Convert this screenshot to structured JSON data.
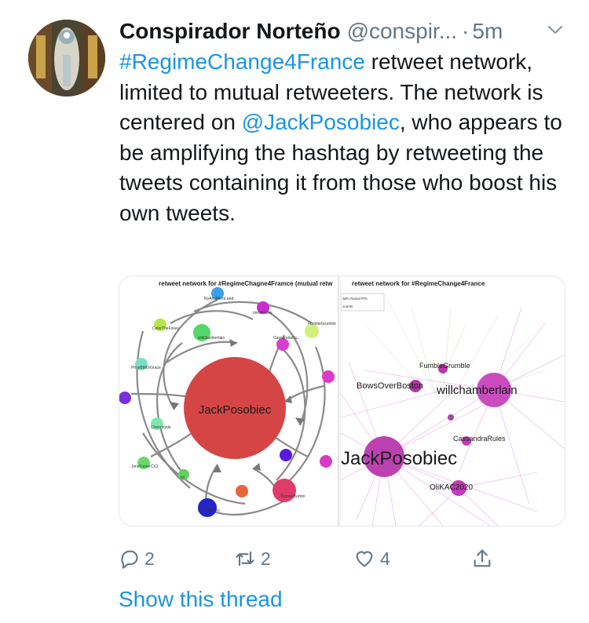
{
  "tweet": {
    "author_name": "Conspirador Norteño",
    "handle": "@conspir...",
    "separator": "·",
    "time": "5m",
    "hashtag": "#RegimeChange4France",
    "text_part1": " retweet network, limited to mutual retweeters. The network is centered on ",
    "mention": "@JackPosobiec",
    "text_part2": ", who appears to be amplifying the hashtag by retweeting the tweets containing it from those who boost his own tweets."
  },
  "media": {
    "left_title": "retweet network for #RegimeChagne4Framce (mutual retw",
    "left_center_label": "JackPosobiec",
    "left_labels": [
      "willchamberlain",
      "CassandraRu..",
      "RyAnuMvrnLand",
      "FumbleGrumble",
      "metabrainz",
      "YvonneBurton",
      "BobertoZero",
      "PhnxBMUrGrace",
      "JimsTurnerCX2",
      "tin",
      "Chenonyde",
      "ColorTheFoxes"
    ],
    "right_title": "retweet network for #RegimeChange4France",
    "right_legend_1": "with mutual RTs",
    "right_legend_2": "counts",
    "right_labels": [
      "FumbleGrumble",
      "BowsOverBoston",
      "willchamberlain",
      "CassandraRules",
      "JackPosobiec",
      "OliKAC2020"
    ]
  },
  "actions": {
    "reply_count": "2",
    "retweet_count": "2",
    "like_count": "4"
  },
  "show_thread": "Show this thread",
  "colors": {
    "link": "#1b95e0",
    "muted": "#657786",
    "node_center": "#d64545",
    "magenta": "#c02ab8"
  }
}
